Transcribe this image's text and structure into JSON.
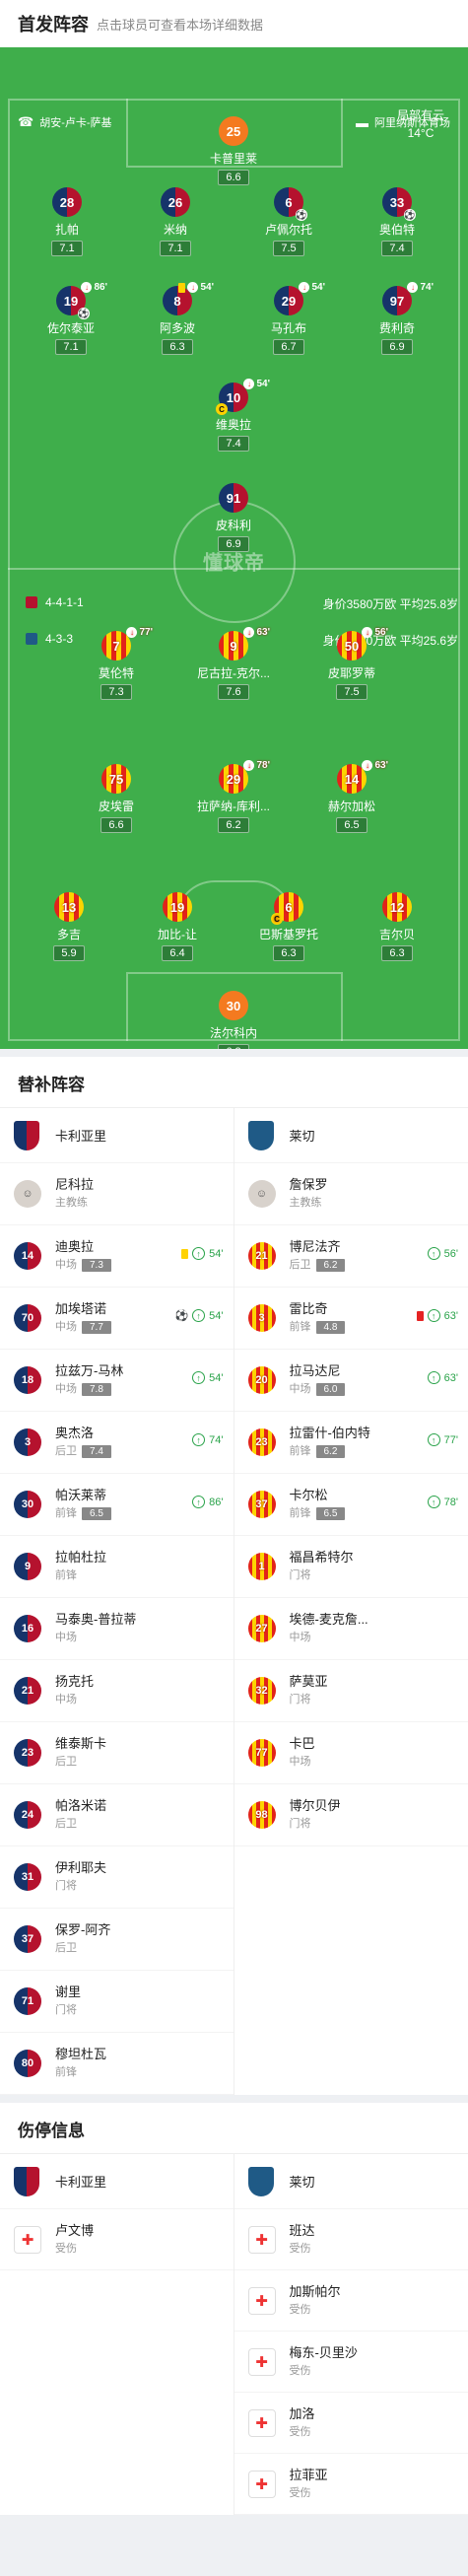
{
  "header": {
    "title": "首发阵容",
    "subtitle": "点击球员可查看本场详细数据"
  },
  "pitch": {
    "home_coach": "胡安-卢卡-萨基",
    "venue": "阿里纳斯体育场",
    "weather": "局部有云",
    "temp": "14°C",
    "watermark": "懂球帝",
    "away_formation": "4-4-1-1",
    "home_formation": "4-3-3",
    "away_value": "身价3580万欧 平均25.8岁",
    "home_value": "身价4730万欧 平均25.6岁"
  },
  "cagliari": [
    {
      "num": "25",
      "name": "卡普里莱",
      "rating": "6.6",
      "kit": "gk1"
    },
    {
      "num": "28",
      "name": "扎帕",
      "rating": "7.1"
    },
    {
      "num": "26",
      "name": "米纳",
      "rating": "7.1"
    },
    {
      "num": "6",
      "name": "卢佩尔托",
      "rating": "7.5",
      "goal": "⚽"
    },
    {
      "num": "33",
      "name": "奥伯特",
      "rating": "7.4",
      "goal": "⚽"
    },
    {
      "num": "19",
      "name": "佐尔泰亚",
      "rating": "7.1",
      "sub": "86'",
      "goal": "⚽"
    },
    {
      "num": "8",
      "name": "阿多波",
      "rating": "6.3",
      "sub": "54'",
      "yc": true
    },
    {
      "num": "29",
      "name": "马孔布",
      "rating": "6.7",
      "sub": "54'"
    },
    {
      "num": "97",
      "name": "费利奇",
      "rating": "6.9",
      "sub": "74'"
    },
    {
      "num": "10",
      "name": "维奥拉",
      "rating": "7.4",
      "sub": "54'",
      "cap": "C"
    },
    {
      "num": "91",
      "name": "皮科利",
      "rating": "6.9"
    }
  ],
  "lecce": [
    {
      "num": "7",
      "name": "莫伦特",
      "rating": "7.3",
      "sub": "77'"
    },
    {
      "num": "9",
      "name": "尼古拉-克尔...",
      "rating": "7.6",
      "sub": "63'"
    },
    {
      "num": "50",
      "name": "皮耶罗蒂",
      "rating": "7.5",
      "sub": "56'"
    },
    {
      "num": "75",
      "name": "皮埃雷",
      "rating": "6.6"
    },
    {
      "num": "29",
      "name": "拉萨纳-库利...",
      "rating": "6.2",
      "sub": "78'"
    },
    {
      "num": "14",
      "name": "赫尔加松",
      "rating": "6.5",
      "sub": "63'"
    },
    {
      "num": "13",
      "name": "多吉",
      "rating": "5.9"
    },
    {
      "num": "19",
      "name": "加比-让",
      "rating": "6.4"
    },
    {
      "num": "6",
      "name": "巴斯基罗托",
      "rating": "6.3",
      "cap": "C"
    },
    {
      "num": "12",
      "name": "吉尔贝",
      "rating": "6.3"
    },
    {
      "num": "30",
      "name": "法尔科内",
      "rating": "6.2",
      "kit": "gk2"
    }
  ],
  "subs": {
    "title": "替补阵容",
    "home_team": "卡利亚里",
    "away_team": "莱切",
    "home_coach": {
      "name": "尼科拉",
      "role": "主教练"
    },
    "away_coach": {
      "name": "詹保罗",
      "role": "主教练"
    },
    "home": [
      {
        "num": "14",
        "name": "迪奥拉",
        "pos": "中场",
        "rating": "7.3",
        "yc": true,
        "min": "54'"
      },
      {
        "num": "70",
        "name": "加埃塔诺",
        "pos": "中场",
        "rating": "7.7",
        "goal": "⚽",
        "min": "54'"
      },
      {
        "num": "18",
        "name": "拉兹万-马林",
        "pos": "中场",
        "rating": "7.8",
        "min": "54'"
      },
      {
        "num": "3",
        "name": "奥杰洛",
        "pos": "后卫",
        "rating": "7.4",
        "min": "74'"
      },
      {
        "num": "30",
        "name": "帕沃莱蒂",
        "pos": "前锋",
        "rating": "6.5",
        "min": "86'"
      },
      {
        "num": "9",
        "name": "拉帕杜拉",
        "pos": "前锋"
      },
      {
        "num": "16",
        "name": "马泰奥-普拉蒂",
        "pos": "中场"
      },
      {
        "num": "21",
        "name": "扬克托",
        "pos": "中场"
      },
      {
        "num": "23",
        "name": "维泰斯卡",
        "pos": "后卫"
      },
      {
        "num": "24",
        "name": "帕洛米诺",
        "pos": "后卫"
      },
      {
        "num": "31",
        "name": "伊利耶夫",
        "pos": "门将"
      },
      {
        "num": "37",
        "name": "保罗-阿齐",
        "pos": "后卫"
      },
      {
        "num": "71",
        "name": "谢里",
        "pos": "门将"
      },
      {
        "num": "80",
        "name": "穆坦杜瓦",
        "pos": "前锋"
      }
    ],
    "away": [
      {
        "num": "21",
        "name": "博尼法齐",
        "pos": "后卫",
        "rating": "6.2",
        "min": "56'"
      },
      {
        "num": "3",
        "name": "雷比奇",
        "pos": "前锋",
        "rating": "4.8",
        "rc": true,
        "min": "63'"
      },
      {
        "num": "20",
        "name": "拉马达尼",
        "pos": "中场",
        "rating": "6.0",
        "min": "63'"
      },
      {
        "num": "23",
        "name": "拉雷什-伯内特",
        "pos": "前锋",
        "rating": "6.2",
        "min": "77'"
      },
      {
        "num": "37",
        "name": "卡尔松",
        "pos": "前锋",
        "rating": "6.5",
        "min": "78'"
      },
      {
        "num": "1",
        "name": "福昌希特尔",
        "pos": "门将"
      },
      {
        "num": "27",
        "name": "埃德-麦克詹...",
        "pos": "中场"
      },
      {
        "num": "32",
        "name": "萨莫亚",
        "pos": "门将"
      },
      {
        "num": "77",
        "name": "卡巴",
        "pos": "中场"
      },
      {
        "num": "98",
        "name": "博尔贝伊",
        "pos": "门将"
      }
    ]
  },
  "injury": {
    "title": "伤停信息",
    "home_team": "卡利亚里",
    "away_team": "莱切",
    "home": [
      {
        "name": "卢文博",
        "status": "受伤"
      }
    ],
    "away": [
      {
        "name": "班达",
        "status": "受伤"
      },
      {
        "name": "加斯帕尔",
        "status": "受伤"
      },
      {
        "name": "梅东-贝里沙",
        "status": "受伤"
      },
      {
        "name": "加洛",
        "status": "受伤"
      },
      {
        "name": "拉菲亚",
        "status": "受伤"
      }
    ]
  }
}
